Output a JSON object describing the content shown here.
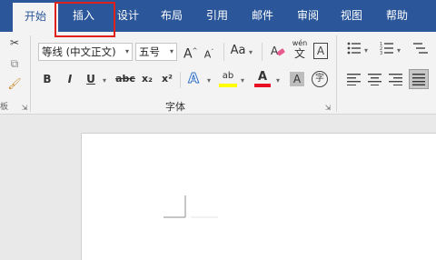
{
  "tabs": [
    {
      "label": "开始"
    },
    {
      "label": "插入"
    },
    {
      "label": "设计"
    },
    {
      "label": "布局"
    },
    {
      "label": "引用"
    },
    {
      "label": "邮件"
    },
    {
      "label": "审阅"
    },
    {
      "label": "视图"
    },
    {
      "label": "帮助"
    }
  ],
  "font_group": {
    "font_name": "等线 (中文正文)",
    "font_size": "五号",
    "label": "字体",
    "bold": "B",
    "italic": "I",
    "underline": "U",
    "strikethrough": "abc",
    "subscript": "x₂",
    "superscript": "x²",
    "grow_font": "A",
    "shrink_font": "A",
    "change_case": "Aa",
    "text_effects": "A",
    "font_color": "A",
    "phonetic_top": "wén",
    "phonetic_main": "文",
    "char_border": "A",
    "enclose_char": "字",
    "highlight_glyph": "ab"
  },
  "colors": {
    "tab_bar": "#2b579a",
    "ribbon": "#f3f3f3",
    "highlight_yellow": "#ffff00",
    "font_red": "#e81123",
    "annotation_red": "#e0201b"
  }
}
